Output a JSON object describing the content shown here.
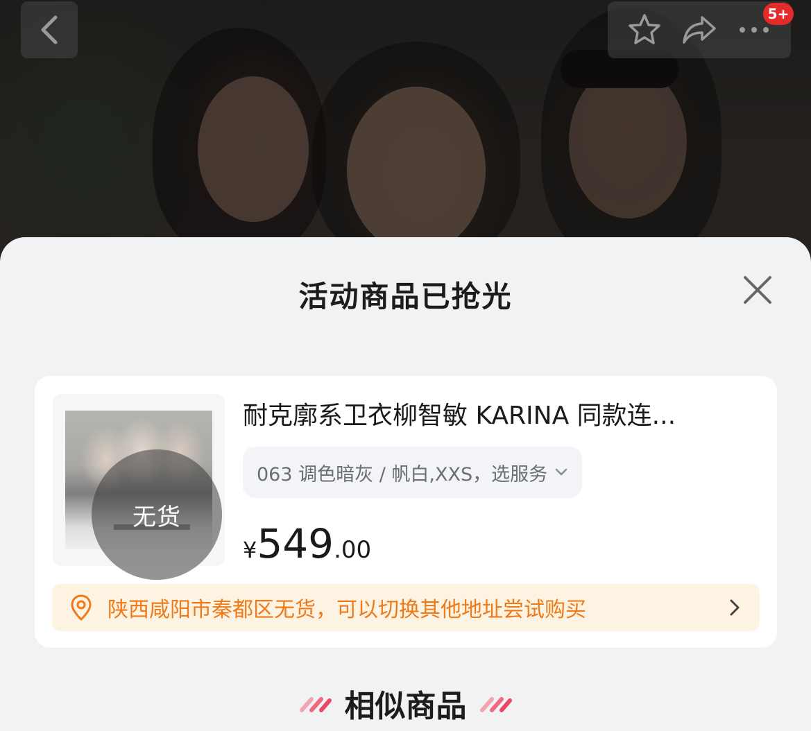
{
  "top_bar": {
    "cart_badge": "5+"
  },
  "sheet": {
    "title": "活动商品已抢光"
  },
  "product": {
    "stock_status": "无货",
    "title": "耐克廓系卫衣柳智敏 KARINA 同款连...",
    "sku_selection": "063 调色暗灰 / 帆白,XXS，选服务",
    "price": {
      "currency": "¥",
      "integer": "549",
      "decimal": ".00"
    }
  },
  "notice": {
    "text": "陕西咸阳市秦都区无货，可以切换其他地址尝试购买"
  },
  "similar": {
    "label": "相似商品"
  },
  "colors": {
    "accent_orange": "#ef7a1a",
    "notice_bg": "#fdf3e2",
    "badge_red": "#e52a2a"
  }
}
